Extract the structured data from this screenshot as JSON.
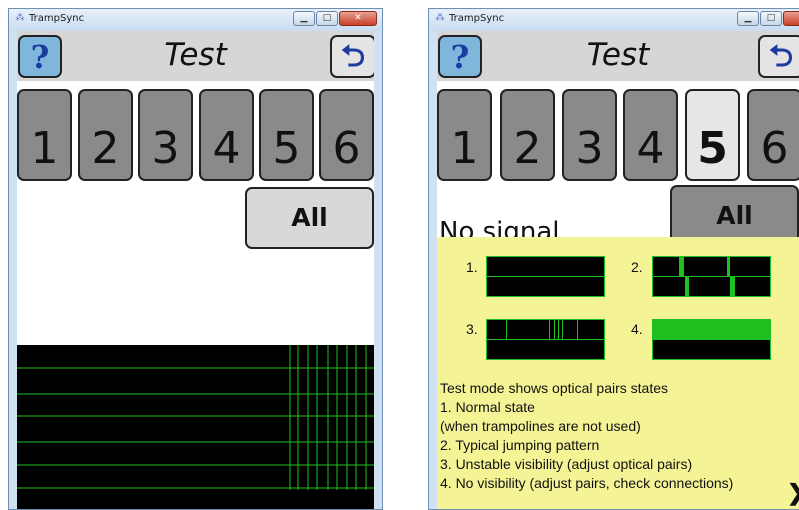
{
  "window": {
    "title": "TrampSync",
    "icon": "trampsync-icon"
  },
  "header": {
    "title": "Test",
    "help_label": "?",
    "back_label": "⮌"
  },
  "trampolines": {
    "buttons": [
      "1",
      "2",
      "3",
      "4",
      "5",
      "6"
    ],
    "all_label": "All"
  },
  "left_screen": {
    "selected": "none"
  },
  "right_screen": {
    "selected": "5",
    "status": "No signal"
  },
  "help": {
    "examples": [
      {
        "label": "1.",
        "meaning": "normal"
      },
      {
        "label": "2.",
        "meaning": "jumping"
      },
      {
        "label": "3.",
        "meaning": "unstable"
      },
      {
        "label": "4.",
        "meaning": "no-visibility"
      }
    ],
    "lines": [
      "Test mode shows optical pairs states",
      "1. Normal state",
      "(when trampolines are not used)",
      "2. Typical jumping pattern",
      "3. Unstable visibility (adjust optical pairs)",
      "4. No visibility (adjust pairs, check connections)"
    ],
    "next_label": "❯"
  },
  "colors": {
    "signal_green": "#1fbf1f",
    "panel_yellow": "#f4f497",
    "button_gray": "#8a8a8a",
    "help_blue": "#7fb7dc"
  }
}
